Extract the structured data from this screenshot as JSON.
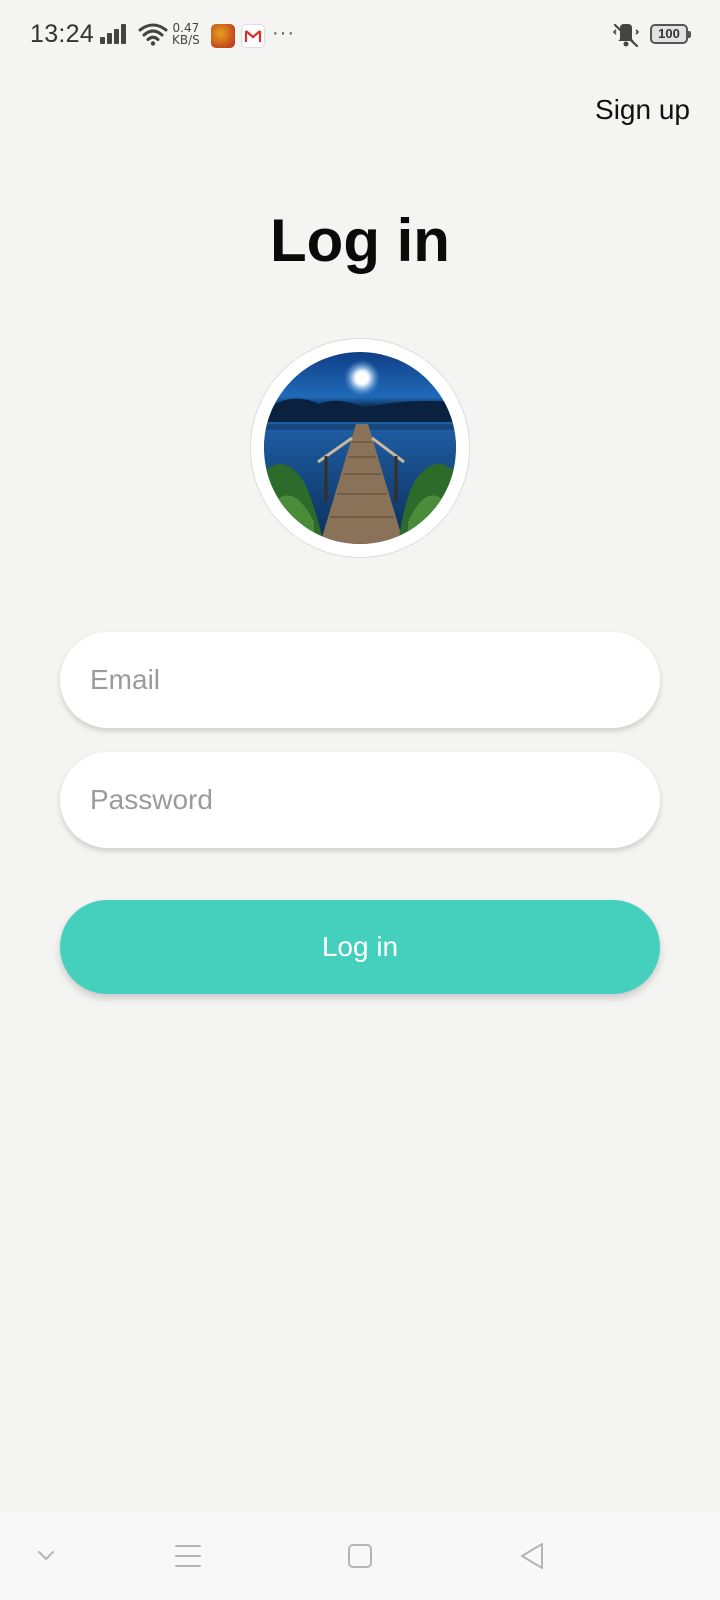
{
  "status_bar": {
    "time": "13:24",
    "net_speed_value": "0.47",
    "net_speed_unit": "KB/S",
    "battery_level": "100",
    "icons": [
      "signal-icon",
      "wifi-icon",
      "app-icon",
      "gmail-icon",
      "more-icon",
      "vibrate-off-icon",
      "battery-icon"
    ]
  },
  "header": {
    "sign_up_label": "Sign up",
    "title": "Log in"
  },
  "form": {
    "email_placeholder": "Email",
    "email_value": "",
    "password_placeholder": "Password",
    "password_value": "",
    "login_button_label": "Log in"
  },
  "colors": {
    "accent": "#45cfbd",
    "background": "#f4f4f2"
  },
  "nav_bar": {
    "icons": [
      "chevron-down-icon",
      "menu-icon",
      "home-square-icon",
      "back-triangle-icon"
    ]
  }
}
